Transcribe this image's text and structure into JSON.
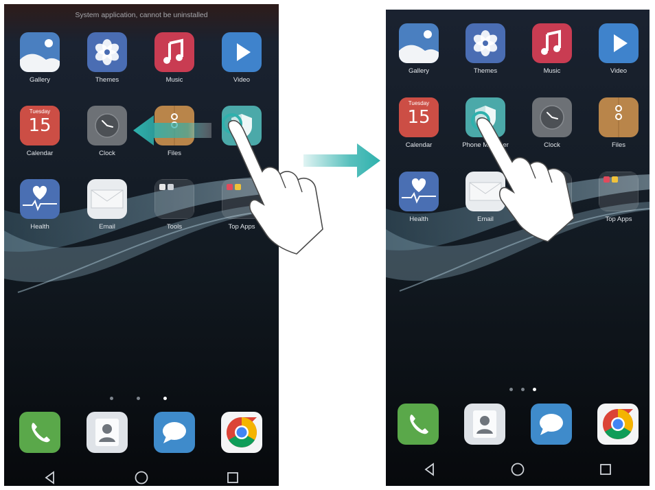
{
  "left_screen": {
    "status_message": "System application, cannot be uninstalled",
    "rows": [
      [
        {
          "name": "gallery",
          "label": "Gallery"
        },
        {
          "name": "themes",
          "label": "Themes"
        },
        {
          "name": "music",
          "label": "Music"
        },
        {
          "name": "video",
          "label": "Video"
        }
      ],
      [
        {
          "name": "calendar",
          "label": "Calendar",
          "day": "Tuesday",
          "date": "15"
        },
        {
          "name": "clock",
          "label": "Clock"
        },
        {
          "name": "files",
          "label": "Files"
        },
        {
          "name": "phone-manager",
          "label": ""
        }
      ],
      [
        {
          "name": "health",
          "label": "Health"
        },
        {
          "name": "email",
          "label": "Email"
        },
        {
          "name": "tools",
          "label": "Tools"
        },
        {
          "name": "top-apps",
          "label": "Top Apps"
        }
      ]
    ],
    "page_indicator": {
      "count": 3,
      "active": 3
    }
  },
  "right_screen": {
    "rows": [
      [
        {
          "name": "gallery",
          "label": "Gallery"
        },
        {
          "name": "themes",
          "label": "Themes"
        },
        {
          "name": "music",
          "label": "Music"
        },
        {
          "name": "video",
          "label": "Video"
        }
      ],
      [
        {
          "name": "calendar",
          "label": "Calendar",
          "day": "Tuesday",
          "date": "15"
        },
        {
          "name": "phone-manager",
          "label": "Phone Manager"
        },
        {
          "name": "clock",
          "label": "Clock"
        },
        {
          "name": "files",
          "label": "Files"
        }
      ],
      [
        {
          "name": "health",
          "label": "Health"
        },
        {
          "name": "email",
          "label": "Email"
        },
        {
          "name": "tools",
          "label": ""
        },
        {
          "name": "top-apps",
          "label": "Top Apps"
        }
      ]
    ],
    "page_indicator": {
      "count": 3,
      "active": 3
    }
  },
  "dock": [
    {
      "name": "phone",
      "icon": "phone-handset-icon"
    },
    {
      "name": "contacts",
      "icon": "contact-person-icon"
    },
    {
      "name": "messaging",
      "icon": "speech-bubble-icon"
    },
    {
      "name": "chrome",
      "icon": "chrome-icon"
    }
  ],
  "nav": [
    "back-triangle-icon",
    "home-circle-icon",
    "recents-square-icon"
  ],
  "colors": {
    "gallery": "#4a7fc0",
    "themes": "#4a6db3",
    "music": "#c93c52",
    "video": "#3f83cc",
    "calendar": "#cc4e45",
    "clock": "#6d7176",
    "files": "#b9854a",
    "phone_manager": "#4ba9a9",
    "health": "#4a6fb3",
    "email": "#e9ecef",
    "phone": "#5aa84a",
    "contacts": "#dfe3e8",
    "messaging": "#3f8bcb",
    "swipe_arrow": "#35b3ad"
  }
}
